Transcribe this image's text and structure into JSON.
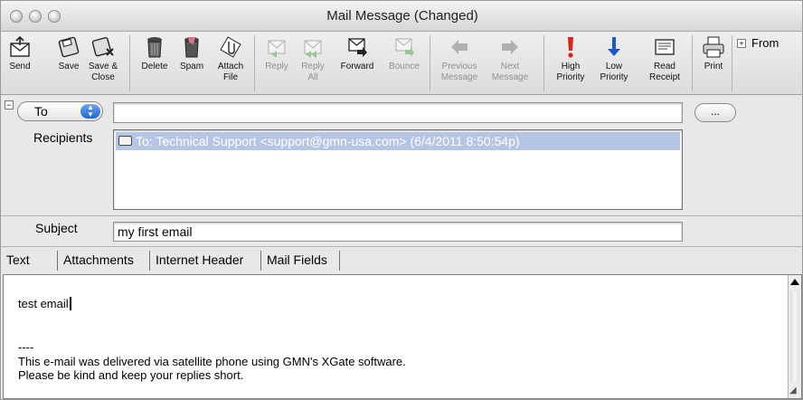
{
  "window": {
    "title": "Mail Message (Changed)"
  },
  "toolbar": {
    "buttons": [
      {
        "label": "Send",
        "enabled": true
      },
      {
        "label": "Save",
        "enabled": true
      },
      {
        "label": "Save &\nClose",
        "enabled": true
      },
      {
        "label": "Delete",
        "enabled": true
      },
      {
        "label": "Spam",
        "enabled": true
      },
      {
        "label": "Attach\nFile",
        "enabled": true
      },
      {
        "label": "Reply",
        "enabled": false
      },
      {
        "label": "Reply\nAll",
        "enabled": false
      },
      {
        "label": "Forward",
        "enabled": true
      },
      {
        "label": "Bounce",
        "enabled": false
      },
      {
        "label": "Previous\nMessage",
        "enabled": false
      },
      {
        "label": "Next\nMessage",
        "enabled": false
      },
      {
        "label": "High\nPriority",
        "enabled": true
      },
      {
        "label": "Low\nPriority",
        "enabled": true
      },
      {
        "label": "Read\nReceipt",
        "enabled": true
      },
      {
        "label": "Print",
        "enabled": true
      }
    ],
    "from_toggle": {
      "box": "+",
      "label": "From"
    }
  },
  "header": {
    "collapse_symbol": "−",
    "recipient_type": "To",
    "address_input_value": "",
    "browse_button": "...",
    "recipients_label": "Recipients",
    "recipients": [
      "To:  Technical Support <support@gmn-usa.com> (6/4/2011 8:50:54p)"
    ],
    "subject_label": "Subject",
    "subject_value": "my first email"
  },
  "tabs": [
    {
      "label": "Text",
      "active": true
    },
    {
      "label": "Attachments",
      "active": false
    },
    {
      "label": "Internet Header",
      "active": false
    },
    {
      "label": "Mail Fields",
      "active": false
    }
  ],
  "body": {
    "first_line": "test email",
    "signature_sep": "----",
    "signature_line1": "This e-mail was delivered via satellite phone using GMN's XGate software.",
    "signature_line2": "Please be kind and keep your replies short."
  },
  "colors": {
    "selection": "#b4c6e4",
    "high_priority": "#e0221a",
    "low_priority": "#1b58c9"
  }
}
